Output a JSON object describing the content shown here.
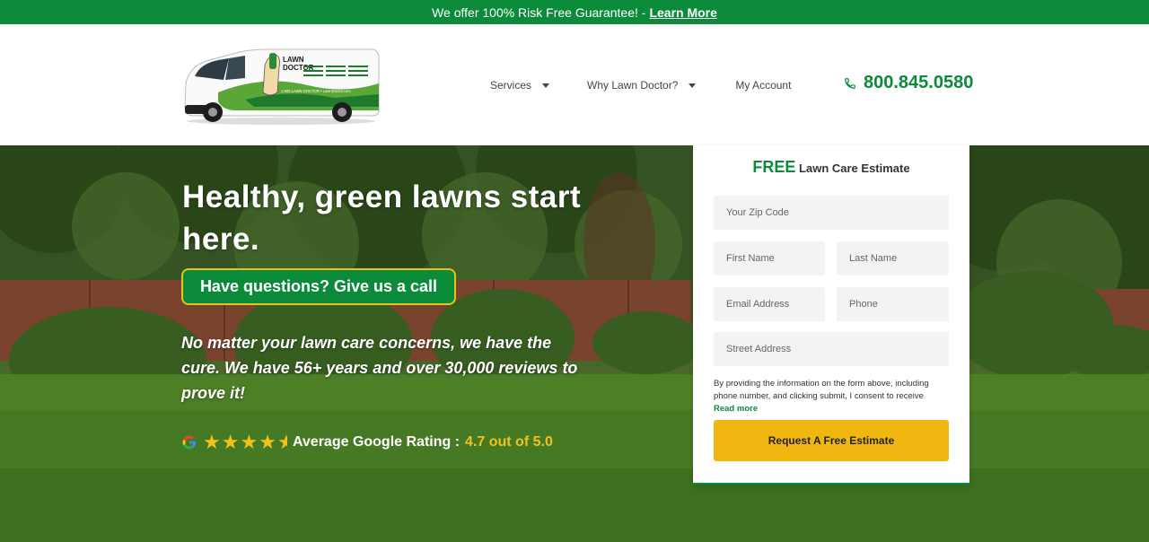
{
  "banner": {
    "text": "We offer 100% Risk Free Guarantee! -",
    "link": "Learn More"
  },
  "logo": {
    "brand_line1": "LAWN",
    "brand_line2": "DOCTOR",
    "van_text": "1.800.LAWN DOCTOR • LawnDoctor.com"
  },
  "nav": {
    "items": [
      {
        "label": "Services"
      },
      {
        "label": "Why Lawn Doctor?"
      },
      {
        "label": "My Account"
      }
    ]
  },
  "phone": {
    "number": "800.845.0580"
  },
  "hero": {
    "title": "Healthy, green lawns start here.",
    "cta": "Have questions? Give us a call",
    "subtitle": "No matter your lawn care concerns, we have the cure. We have 56+ years and over 30,000 reviews to prove it!",
    "rating_label": "Average Google Rating :",
    "rating_value": "4.7 out of 5.0",
    "rating_stars": 4.5
  },
  "form": {
    "title_free": "FREE",
    "title_rest": "Lawn Care Estimate",
    "zip_placeholder": "Your Zip Code",
    "first_placeholder": "First Name",
    "last_placeholder": "Last Name",
    "email_placeholder": "Email Address",
    "phone_placeholder": "Phone",
    "street_placeholder": "Street Address",
    "consent": "By providing the information on the form above, including phone number, and clicking submit, I consent to receive",
    "read_more": "Read more",
    "submit": "Request A Free Estimate"
  },
  "colors": {
    "brand_green": "#0b8a3a",
    "cta_yellow": "#f0b711",
    "star": "#f2c21a"
  }
}
